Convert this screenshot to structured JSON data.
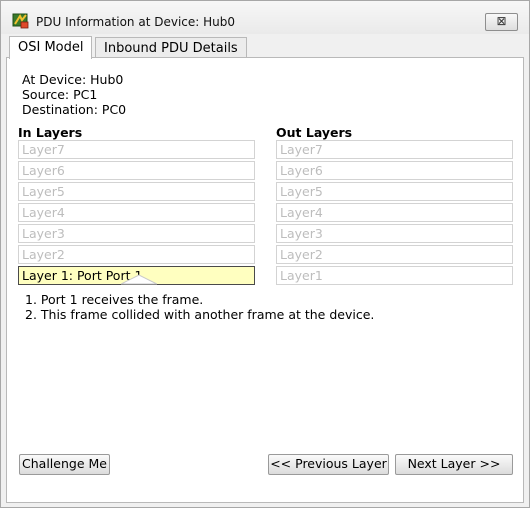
{
  "window": {
    "title": "PDU Information at Device: Hub0",
    "close_symbol": "⊠"
  },
  "tabs": [
    {
      "label": "OSI Model",
      "active": true
    },
    {
      "label": "Inbound PDU Details",
      "active": false
    }
  ],
  "info": {
    "device": "At Device: Hub0",
    "source": "Source: PC1",
    "destination": "Destination: PC0"
  },
  "in_layers": {
    "heading": "In Layers",
    "items": [
      "Layer7",
      "Layer6",
      "Layer5",
      "Layer4",
      "Layer3",
      "Layer2",
      "Layer 1: Port Port 1"
    ],
    "active_index": 6
  },
  "out_layers": {
    "heading": "Out Layers",
    "items": [
      "Layer7",
      "Layer6",
      "Layer5",
      "Layer4",
      "Layer3",
      "Layer2",
      "Layer1"
    ]
  },
  "steps": [
    "1. Port 1 receives the frame.",
    "2. This frame collided with another frame at the device."
  ],
  "buttons": {
    "challenge": "Challenge Me",
    "previous": "<< Previous Layer",
    "next": "Next Layer >>"
  },
  "colors": {
    "active_layer_bg": "#ffffc0",
    "inactive_layer_text": "#bdbdbd"
  },
  "icons": {
    "app": "packet-tracer-icon",
    "close": "close-icon"
  }
}
